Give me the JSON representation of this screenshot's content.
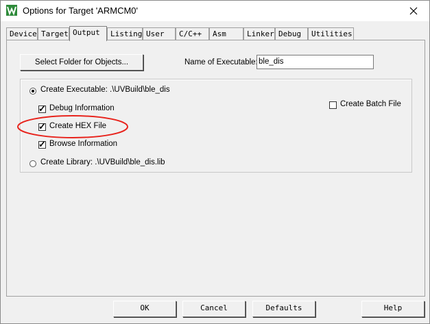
{
  "window": {
    "title": "Options for Target 'ARMCM0'"
  },
  "tabs": [
    {
      "label": "Device"
    },
    {
      "label": "Target"
    },
    {
      "label": "Output"
    },
    {
      "label": "Listing"
    },
    {
      "label": "User"
    },
    {
      "label": "C/C++"
    },
    {
      "label": "Asm"
    },
    {
      "label": "Linker"
    },
    {
      "label": "Debug"
    },
    {
      "label": "Utilities"
    }
  ],
  "output": {
    "select_folder_label": "Select Folder for Objects...",
    "name_exec_label": "Name of Executable:",
    "name_exec_value": "ble_dis",
    "create_exec_label": "Create Executable:  .\\UVBuild\\ble_dis",
    "debug_info_label": "Debug Information",
    "create_hex_label": "Create HEX File",
    "browse_info_label": "Browse Information",
    "create_lib_label": "Create Library:  .\\UVBuild\\ble_dis.lib",
    "create_batch_label": "Create Batch File",
    "debug_info_checked": true,
    "create_hex_checked": true,
    "browse_info_checked": true,
    "create_batch_checked": false,
    "create_exec_selected": true,
    "highlight_color": "#e8231c"
  },
  "buttons": {
    "ok": "OK",
    "cancel": "Cancel",
    "defaults": "Defaults",
    "help": "Help"
  }
}
